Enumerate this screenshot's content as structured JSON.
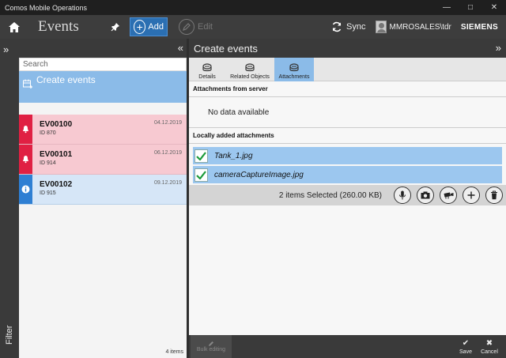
{
  "window": {
    "title": "Comos Mobile Operations"
  },
  "header": {
    "app_title": "Events",
    "add_label": "Add",
    "edit_label": "Edit",
    "sync_label": "Sync",
    "user": "MMROSALES\\tdr",
    "brand": "SIEMENS"
  },
  "rail": {
    "filter_label": "Filter"
  },
  "list": {
    "search_placeholder": "Search",
    "create_label": "Create events",
    "items": [
      {
        "id": "EV00100",
        "sub": "ID 870",
        "date": "04.12.2019",
        "status": "alarm"
      },
      {
        "id": "EV00101",
        "sub": "ID 914",
        "date": "06.12.2019",
        "status": "alarm"
      },
      {
        "id": "EV00102",
        "sub": "ID 915",
        "date": "09.12.2019",
        "status": "info"
      }
    ],
    "count": "4 items"
  },
  "detail": {
    "title": "Create events",
    "tabs": [
      {
        "label": "Details",
        "active": false
      },
      {
        "label": "Related Objects",
        "active": false
      },
      {
        "label": "Attachments",
        "active": true
      }
    ],
    "server_section": "Attachments from server",
    "no_data": "No data available",
    "local_section": "Locally added attachments",
    "attachments": [
      {
        "name": "Tank_1.jpg",
        "checked": true
      },
      {
        "name": "cameraCaptureImage.jpg",
        "checked": true
      }
    ],
    "selected_summary": "2 items Selected (260.00 KB)"
  },
  "bottom": {
    "bulk_label": "Bulk editing",
    "save_label": "Save",
    "cancel_label": "Cancel"
  },
  "colors": {
    "accent": "#2b6fb2",
    "selected": "#8bbbe8",
    "alarm": "#e02043",
    "info": "#2e7fd3"
  }
}
